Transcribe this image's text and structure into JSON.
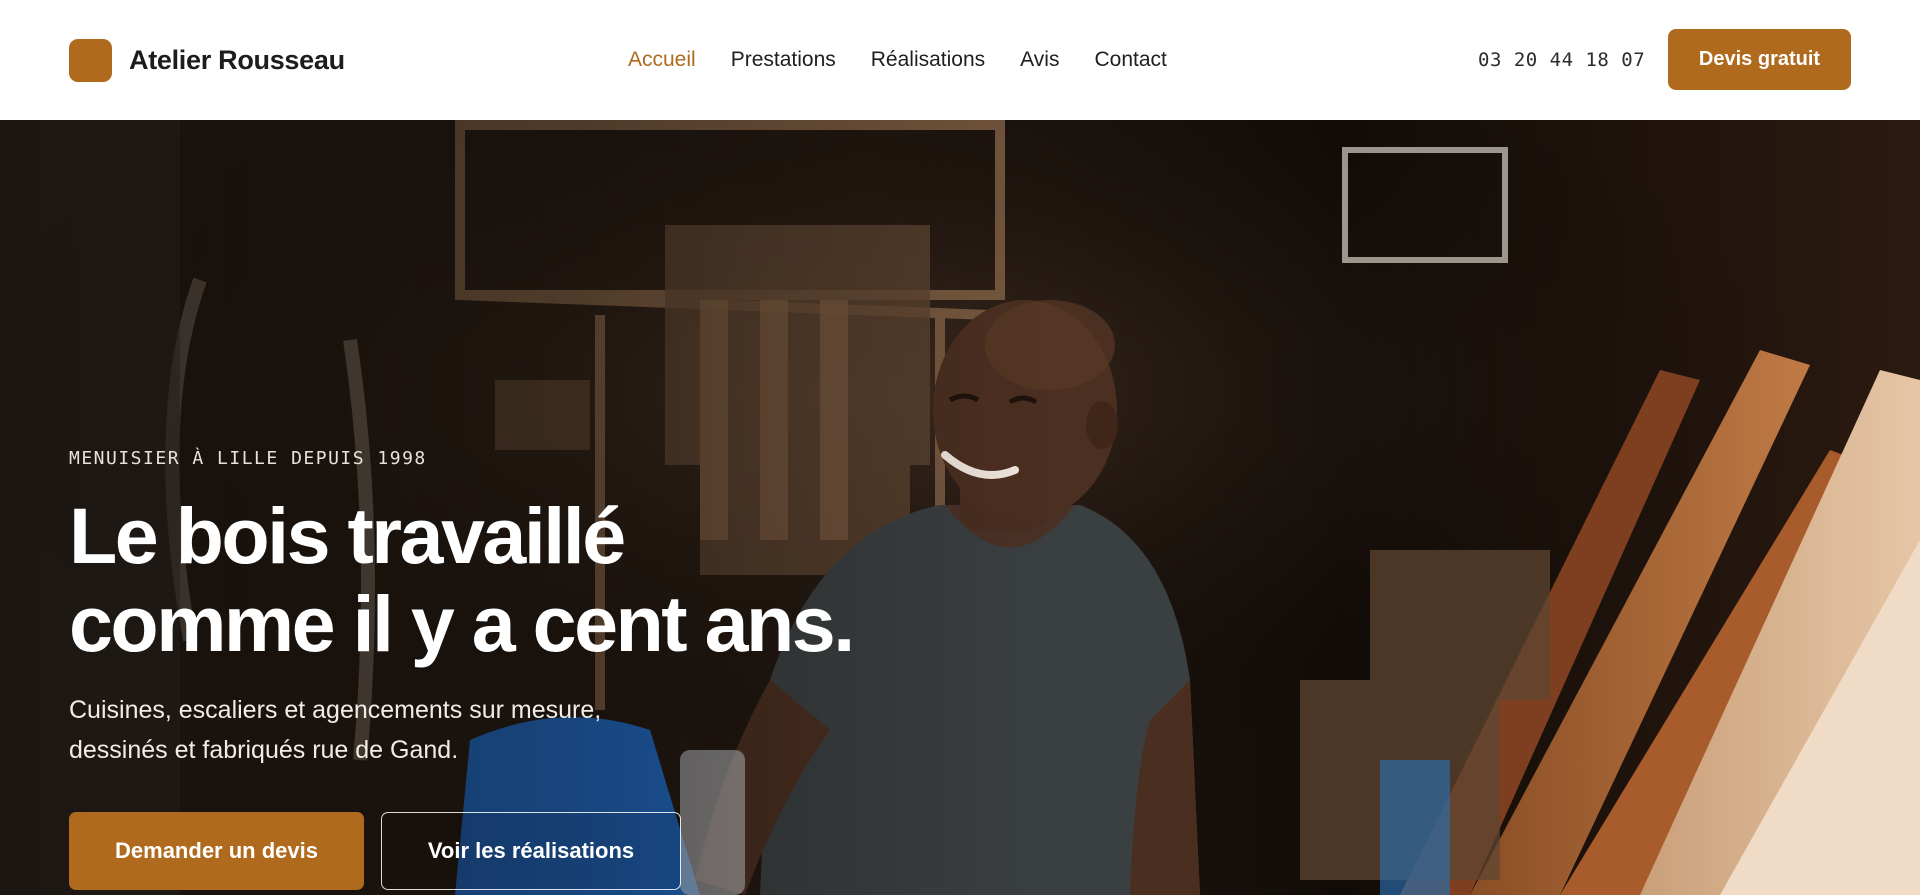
{
  "brand": {
    "name": "Atelier Rousseau",
    "accent": "#b06a1e"
  },
  "nav": {
    "items": [
      {
        "label": "Accueil",
        "active": true
      },
      {
        "label": "Prestations",
        "active": false
      },
      {
        "label": "Réalisations",
        "active": false
      },
      {
        "label": "Avis",
        "active": false
      },
      {
        "label": "Contact",
        "active": false
      }
    ]
  },
  "header": {
    "phone": "03 20 44 18 07",
    "cta_label": "Devis gratuit"
  },
  "hero": {
    "eyebrow": "MENUISIER À LILLE DEPUIS 1998",
    "headline_lines": [
      "Le bois travaillé",
      "comme il y a cent ans."
    ],
    "subline_lines": [
      "Cuisines, escaliers et agencements sur mesure,",
      "dessinés et fabriqués rue de Gand."
    ],
    "primary_cta": "Demander un devis",
    "secondary_cta": "Voir les réalisations",
    "image_subject": "craftsman-in-workshop"
  }
}
